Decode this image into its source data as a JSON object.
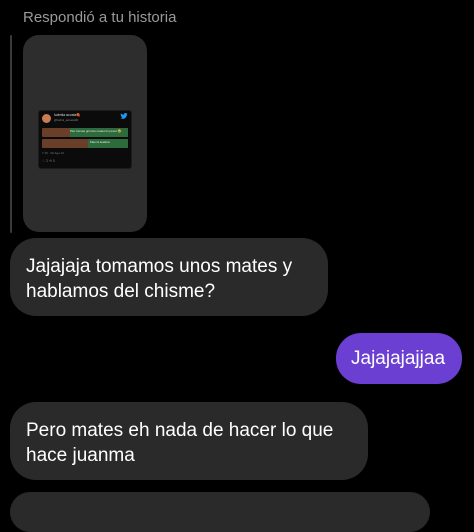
{
  "reply_header": "Respondió a tu historia",
  "story": {
    "emojis": "😂😂😂",
    "tweet": {
      "name": "ludmila acosta🍓",
      "handle": "@ludmi_acosta00",
      "row1_text": "Pier tuimas grnmce mates lin pecel 😂",
      "row2_text": "Mae la tealaria",
      "timestamp": "7:15 · 09 Ago 22",
      "stats": "♡ 2   ⟲ 0"
    }
  },
  "messages": [
    {
      "direction": "incoming",
      "text": "Jajajaja tomamos unos mates y hablamos del chisme?"
    },
    {
      "direction": "outgoing",
      "text": "Jajajajajjaa"
    },
    {
      "direction": "incoming",
      "text": "Pero mates eh nada de hacer lo que hace juanma"
    },
    {
      "direction": "incoming",
      "text": ""
    }
  ],
  "colors": {
    "background": "#000000",
    "incoming_bubble": "#2a2a2a",
    "outgoing_bubble": "#6c3fd3",
    "header_text": "#9a9a9a"
  }
}
